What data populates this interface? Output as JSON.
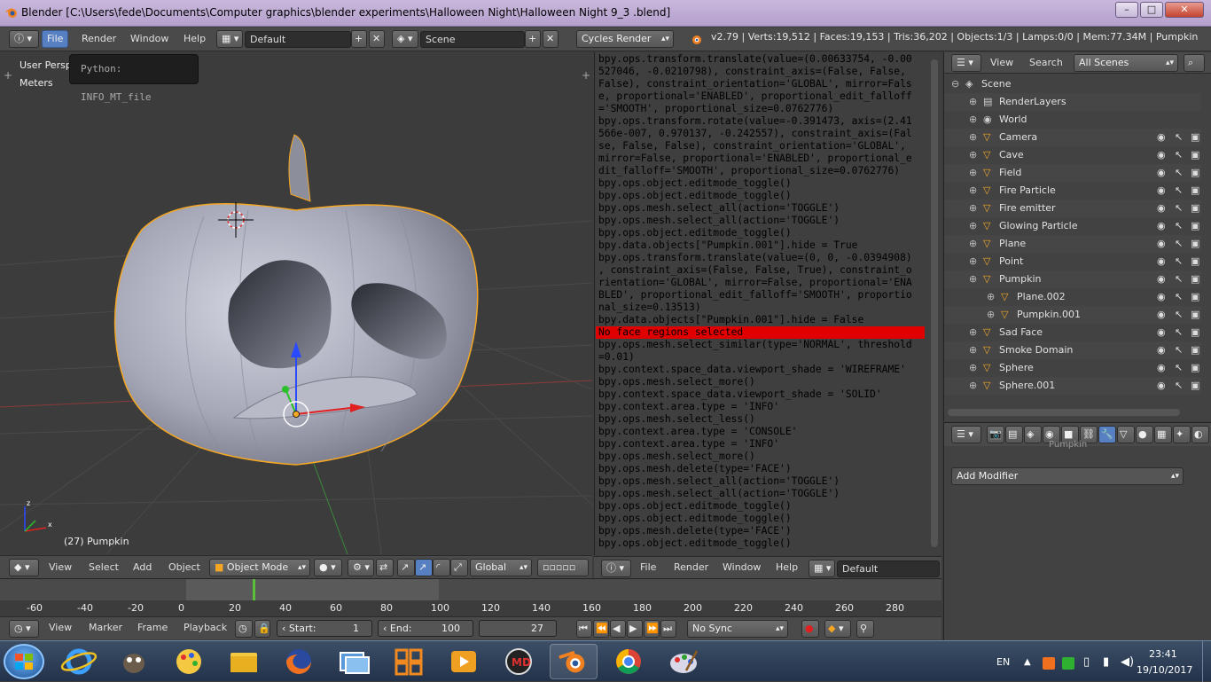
{
  "window": {
    "title": "Blender [C:\\Users\\fede\\Documents\\Computer graphics\\blender experiments\\Halloween Night\\Halloween Night 9_3 .blend]",
    "btn_min": "–",
    "btn_max": "□",
    "btn_close": "✕"
  },
  "infobar": {
    "menu": [
      "File",
      "Render",
      "Window",
      "Help"
    ],
    "layout": "Default",
    "scene": "Scene",
    "engine": "Cycles Render",
    "stats": "v2.79 | Verts:19,512 | Faces:19,153 | Tris:36,202 | Objects:1/3 | Lamps:0/0 | Mem:77.34M | Pumpkin"
  },
  "viewport": {
    "view_name": "User Persp",
    "units": "Meters",
    "tooltip": "Python: INFO_MT_file",
    "object_label": "(27) Pumpkin",
    "header": {
      "menu": [
        "View",
        "Select",
        "Add",
        "Object"
      ],
      "mode": "Object Mode",
      "orientation": "Global"
    }
  },
  "console": {
    "lines": [
      "bpy.ops.transform.translate(value=(0.00633754, -0.00",
      "527046, -0.0210798), constraint_axis=(False, False,",
      "False), constraint_orientation='GLOBAL', mirror=Fals",
      "e, proportional='ENABLED', proportional_edit_falloff",
      "='SMOOTH', proportional_size=0.0762776)",
      "bpy.ops.transform.rotate(value=-0.391473, axis=(2.41",
      "566e-007, 0.970137, -0.242557), constraint_axis=(Fal",
      "se, False, False), constraint_orientation='GLOBAL',",
      "mirror=False, proportional='ENABLED', proportional_e",
      "dit_falloff='SMOOTH', proportional_size=0.0762776)",
      "bpy.ops.object.editmode_toggle()",
      "bpy.ops.object.editmode_toggle()",
      "bpy.ops.mesh.select_all(action='TOGGLE')",
      "bpy.ops.mesh.select_all(action='TOGGLE')",
      "bpy.ops.object.editmode_toggle()",
      "bpy.data.objects[\"Pumpkin.001\"].hide = True",
      "bpy.ops.transform.translate(value=(0, 0, -0.0394908)",
      ", constraint_axis=(False, False, True), constraint_o",
      "rientation='GLOBAL', mirror=False, proportional='ENA",
      "BLED', proportional_edit_falloff='SMOOTH', proportio",
      "nal_size=0.13513)",
      "bpy.data.objects[\"Pumpkin.001\"].hide = False",
      "No face regions selected",
      "bpy.ops.mesh.select_similar(type='NORMAL', threshold",
      "=0.01)",
      "bpy.context.space_data.viewport_shade = 'WIREFRAME'",
      "bpy.ops.mesh.select_more()",
      "bpy.context.space_data.viewport_shade = 'SOLID'",
      "bpy.context.area.type = 'INFO'",
      "bpy.ops.mesh.select_less()",
      "bpy.context.area.type = 'CONSOLE'",
      "bpy.context.area.type = 'INFO'",
      "bpy.ops.mesh.select_more()",
      "bpy.ops.mesh.delete(type='FACE')",
      "bpy.ops.mesh.select_all(action='TOGGLE')",
      "bpy.ops.mesh.select_all(action='TOGGLE')",
      "bpy.ops.object.editmode_toggle()",
      "bpy.ops.object.editmode_toggle()",
      "bpy.ops.mesh.delete(type='FACE')",
      "bpy.ops.object.editmode_toggle()"
    ],
    "header": {
      "menu": [
        "File",
        "Render",
        "Window",
        "Help"
      ],
      "layout": "Default"
    }
  },
  "outliner": {
    "menu": [
      "View",
      "Search"
    ],
    "filter": "All Scenes",
    "items": [
      {
        "name": "Scene",
        "indent": 0
      },
      {
        "name": "RenderLayers",
        "indent": 1
      },
      {
        "name": "World",
        "indent": 1
      },
      {
        "name": "Camera",
        "indent": 1
      },
      {
        "name": "Cave",
        "indent": 1
      },
      {
        "name": "Field",
        "indent": 1
      },
      {
        "name": "Fire Particle",
        "indent": 1
      },
      {
        "name": "Fire emitter",
        "indent": 1
      },
      {
        "name": "Glowing Particle",
        "indent": 1
      },
      {
        "name": "Plane",
        "indent": 1
      },
      {
        "name": "Point",
        "indent": 1
      },
      {
        "name": "Pumpkin",
        "indent": 1
      },
      {
        "name": "Plane.002",
        "indent": 2
      },
      {
        "name": "Pumpkin.001",
        "indent": 2
      },
      {
        "name": "Sad Face",
        "indent": 1
      },
      {
        "name": "Smoke Domain",
        "indent": 1
      },
      {
        "name": "Sphere",
        "indent": 1
      },
      {
        "name": "Sphere.001",
        "indent": 1
      }
    ]
  },
  "properties": {
    "partial_label": "Pumpkin",
    "add_modifier": "Add Modifier"
  },
  "timeline": {
    "ruler": [
      "-60",
      "-40",
      "-20",
      "0",
      "20",
      "40",
      "60",
      "80",
      "100",
      "120",
      "140",
      "160",
      "180",
      "200",
      "220",
      "240",
      "260",
      "280"
    ],
    "current_frame_marker": 27,
    "header": {
      "menu": [
        "View",
        "Marker",
        "Frame",
        "Playback"
      ],
      "start_label": "Start:",
      "start": "1",
      "end_label": "End:",
      "end": "100",
      "current": "27",
      "sync": "No Sync"
    }
  },
  "taskbar": {
    "lang": "EN",
    "time": "23:41",
    "date": "19/10/2017"
  },
  "colors": {
    "accent_orange": "#f5a623",
    "error_red": "#e10000",
    "active_blue": "#5680c2"
  }
}
